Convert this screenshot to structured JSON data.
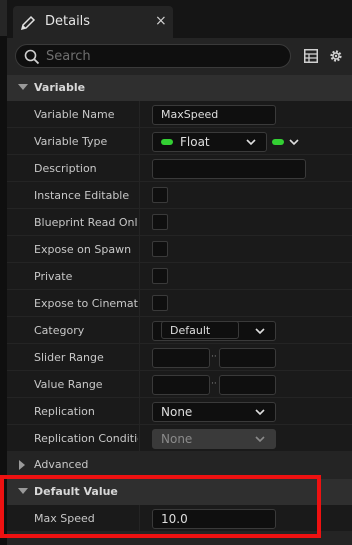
{
  "tab": {
    "title": "Details",
    "close": "×"
  },
  "search": {
    "placeholder": "Search"
  },
  "sections": {
    "variable": "Variable",
    "default_value": "Default Value"
  },
  "rows": {
    "variable_name": {
      "label": "Variable Name",
      "value": "MaxSpeed"
    },
    "variable_type": {
      "label": "Variable Type",
      "value": "Float",
      "pill_color": "#33d033"
    },
    "description": {
      "label": "Description",
      "value": ""
    },
    "instance_editable": {
      "label": "Instance Editable",
      "checked": false
    },
    "blueprint_read_only": {
      "label": "Blueprint Read Only",
      "checked": false
    },
    "expose_on_spawn": {
      "label": "Expose on Spawn",
      "checked": false
    },
    "private": {
      "label": "Private",
      "checked": false
    },
    "expose_to_cinematics": {
      "label": "Expose to Cinematics",
      "checked": false
    },
    "category": {
      "label": "Category",
      "value": "Default"
    },
    "slider_range": {
      "label": "Slider Range",
      "min": "",
      "max": "",
      "sep": "··"
    },
    "value_range": {
      "label": "Value Range",
      "min": "",
      "max": "",
      "sep": "··"
    },
    "replication": {
      "label": "Replication",
      "value": "None"
    },
    "replication_condition": {
      "label": "Replication Condition",
      "value": "None"
    },
    "max_speed": {
      "label": "Max Speed",
      "value": "10.0"
    }
  },
  "advanced": {
    "label": "Advanced"
  },
  "colors": {
    "accent_highlight": "#ee1111",
    "float_pin": "#33d033"
  }
}
